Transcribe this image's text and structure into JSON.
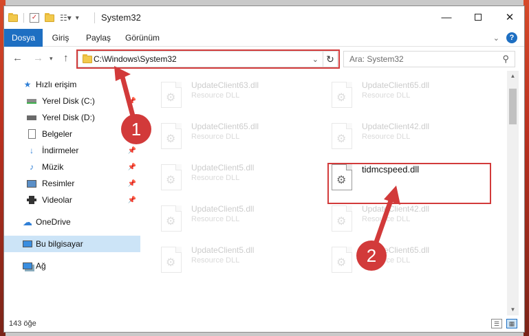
{
  "window": {
    "title": "System32",
    "minimize_icon": "minimize-icon",
    "maximize_icon": "maximize-icon",
    "close_icon": "close-icon"
  },
  "ribbon": {
    "tabs": [
      {
        "label": "Dosya",
        "active": true
      },
      {
        "label": "Giriş",
        "active": false
      },
      {
        "label": "Paylaş",
        "active": false
      },
      {
        "label": "Görünüm",
        "active": false
      }
    ]
  },
  "nav": {
    "address": "C:\\Windows\\System32",
    "search_placeholder": "Ara: System32"
  },
  "sidebar": {
    "items": [
      {
        "label": "Hızlı erişim",
        "icon": "star-icon"
      },
      {
        "label": "Yerel Disk (C:)",
        "icon": "drive-icon"
      },
      {
        "label": "Yerel Disk (D:)",
        "icon": "drive-icon"
      },
      {
        "label": "Belgeler",
        "icon": "document-icon"
      },
      {
        "label": "İndirmeler",
        "icon": "download-icon"
      },
      {
        "label": "Müzik",
        "icon": "music-icon"
      },
      {
        "label": "Resimler",
        "icon": "pictures-icon"
      },
      {
        "label": "Videolar",
        "icon": "video-icon"
      },
      {
        "label": "OneDrive",
        "icon": "cloud-icon"
      },
      {
        "label": "Bu bilgisayar",
        "icon": "computer-icon",
        "selected": true
      },
      {
        "label": "Ağ",
        "icon": "network-icon"
      }
    ]
  },
  "files": [
    {
      "name": "UpdateClient63.dll",
      "desc": "Resource DLL"
    },
    {
      "name": "UpdateClient65.dll",
      "desc": "Resource DLL"
    },
    {
      "name": "UpdateClient65.dll",
      "desc": "Resource DLL"
    },
    {
      "name": "UpdateClient42.dll",
      "desc": "Resource DLL"
    },
    {
      "name": "UpdateClient5.dll",
      "desc": "Resource DLL"
    },
    {
      "name": "tidmcspeed.dll",
      "desc": ""
    },
    {
      "name": "UpdateClient5.dll",
      "desc": "Resource DLL"
    },
    {
      "name": "UpdateClient42.dll",
      "desc": "Resource DLL"
    },
    {
      "name": "UpdateClient5.dll",
      "desc": "Resource DLL"
    },
    {
      "name": "UpdateClient65.dll",
      "desc": "Resource DLL"
    }
  ],
  "status": {
    "item_count": "143 öğe"
  },
  "annotations": {
    "step1": "1",
    "step2": "2",
    "color": "#d23a3a"
  }
}
